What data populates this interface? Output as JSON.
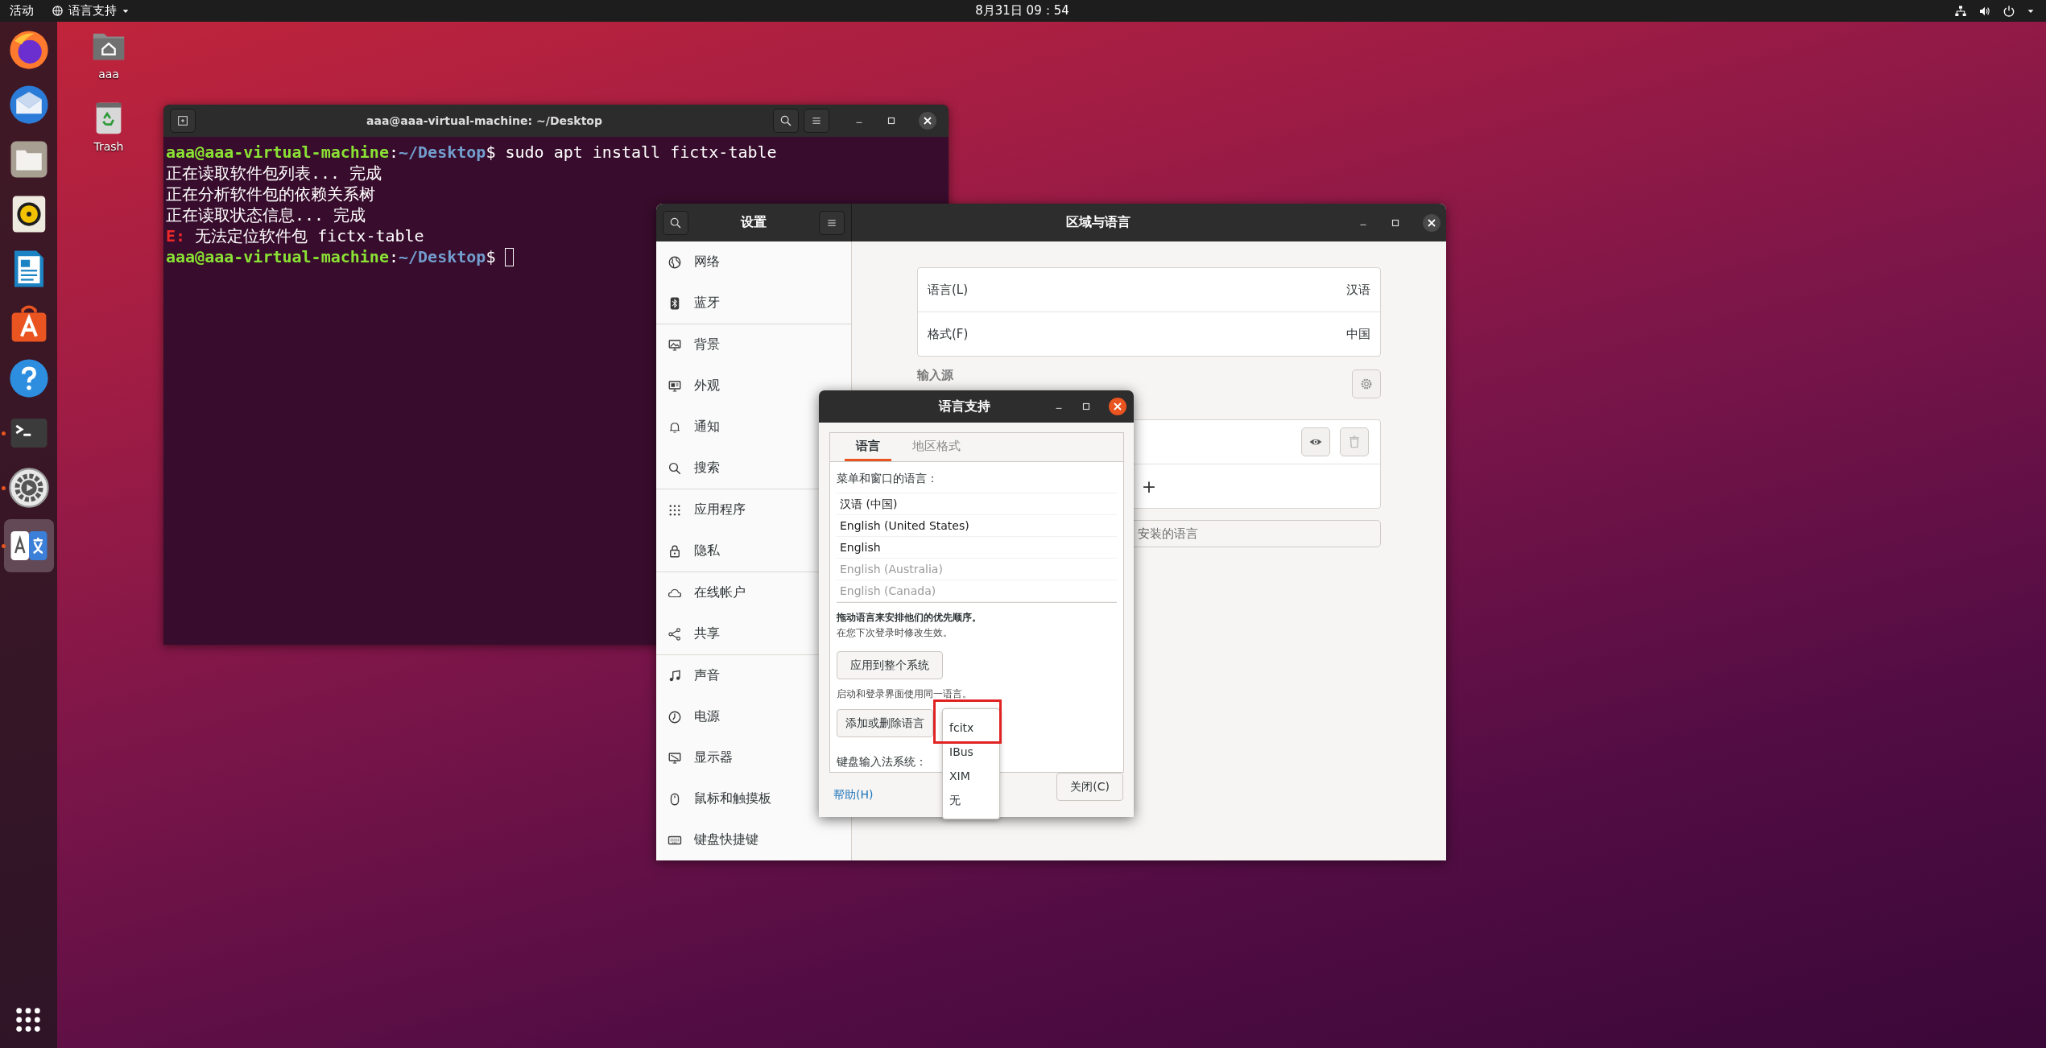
{
  "top_bar": {
    "activities": "活动",
    "app_menu": "语言支持",
    "clock": "8月31日  09：54"
  },
  "dock": {
    "items": [
      {
        "kind": "browser",
        "running": false,
        "selected": false
      },
      {
        "kind": "mail",
        "running": false,
        "selected": false
      },
      {
        "kind": "files",
        "running": false,
        "selected": false
      },
      {
        "kind": "music",
        "running": false,
        "selected": false
      },
      {
        "kind": "writer",
        "running": false,
        "selected": false
      },
      {
        "kind": "software",
        "running": false,
        "selected": false
      },
      {
        "kind": "help",
        "running": false,
        "selected": false
      },
      {
        "kind": "terminal",
        "running": true,
        "selected": false
      },
      {
        "kind": "settings",
        "running": true,
        "selected": false
      },
      {
        "kind": "language",
        "running": true,
        "selected": true
      }
    ]
  },
  "desktop_icons": [
    {
      "kind": "home",
      "label": "aaa"
    },
    {
      "kind": "trash",
      "label": "Trash"
    }
  ],
  "terminal": {
    "title": "aaa@aaa-virtual-machine: ~/Desktop",
    "lines": [
      {
        "segments": [
          {
            "kind": "user",
            "text": "aaa@aaa-virtual-machine"
          },
          {
            "kind": "plain",
            "text": ":"
          },
          {
            "kind": "path",
            "text": "~/Desktop"
          },
          {
            "kind": "plain",
            "text": "$ sudo apt install fictx-table"
          }
        ]
      },
      {
        "segments": [
          {
            "kind": "plain",
            "text": "正在读取软件包列表... 完成"
          }
        ]
      },
      {
        "segments": [
          {
            "kind": "plain",
            "text": "正在分析软件包的依赖关系树"
          }
        ]
      },
      {
        "segments": [
          {
            "kind": "plain",
            "text": "正在读取状态信息... 完成"
          }
        ]
      },
      {
        "segments": [
          {
            "kind": "error",
            "text": "E:"
          },
          {
            "kind": "plain",
            "text": " 无法定位软件包 fictx-table"
          }
        ]
      },
      {
        "segments": [
          {
            "kind": "user",
            "text": "aaa@aaa-virtual-machine"
          },
          {
            "kind": "plain",
            "text": ":"
          },
          {
            "kind": "path",
            "text": "~/Desktop"
          },
          {
            "kind": "plain",
            "text": "$"
          }
        ]
      }
    ],
    "cursor": true
  },
  "settings": {
    "sidebar_title": "设置",
    "page_title": "区域与语言",
    "sidebar": {
      "groups": [
        [
          {
            "kind": "network",
            "label": "网络"
          },
          {
            "kind": "bluetooth",
            "label": "蓝牙"
          }
        ],
        [
          {
            "kind": "background",
            "label": "背景"
          },
          {
            "kind": "appearance",
            "label": "外观"
          },
          {
            "kind": "notification",
            "label": "通知"
          },
          {
            "kind": "search",
            "label": "搜索"
          }
        ],
        [
          {
            "kind": "apps",
            "label": "应用程序"
          },
          {
            "kind": "privacy",
            "label": "隐私"
          }
        ],
        [
          {
            "kind": "online",
            "label": "在线帐户"
          },
          {
            "kind": "sharing",
            "label": "共享"
          }
        ],
        [
          {
            "kind": "sound",
            "label": "声音"
          },
          {
            "kind": "power",
            "label": "电源"
          },
          {
            "kind": "display",
            "label": "显示器"
          },
          {
            "kind": "mouse",
            "label": "鼠标和触摸板"
          },
          {
            "kind": "keyboard",
            "label": "键盘快捷键"
          }
        ]
      ]
    },
    "region_rows": [
      {
        "label": "语言(L)",
        "value": "汉语"
      },
      {
        "label": "格式(F)",
        "value": "中国"
      }
    ],
    "input_sources_heading": "输入源",
    "add_source": "+",
    "installed_languages_button": "安装的语言"
  },
  "language_dialog": {
    "title": "语言支持",
    "tabs": [
      {
        "label": "语言",
        "selected": true
      },
      {
        "label": "地区格式",
        "selected": false
      }
    ],
    "list_label": "菜单和窗口的语言：",
    "languages": [
      {
        "name": "汉语 (中国)",
        "enabled": true
      },
      {
        "name": "English (United States)",
        "enabled": true
      },
      {
        "name": "English",
        "enabled": true
      },
      {
        "name": "English (Australia)",
        "enabled": false
      },
      {
        "name": "English (Canada)",
        "enabled": false
      }
    ],
    "hint_bold": "拖动语言来安排他们的优先顺序。",
    "hint": "在您下次登录时修改生效。",
    "apply_button": "应用到整个系统",
    "apply_note": "启动和登录界面使用同一语言。",
    "add_remove_button": "添加或删除语言",
    "im_label": "键盘输入法系统：",
    "im_options": [
      {
        "label": "fcitx",
        "annotated": true
      },
      {
        "label": "IBus",
        "annotated": false
      },
      {
        "label": "XIM",
        "annotated": false
      },
      {
        "label": "无",
        "annotated": false
      }
    ],
    "help_link": "帮助(H)",
    "close_button": "关闭(C)"
  }
}
